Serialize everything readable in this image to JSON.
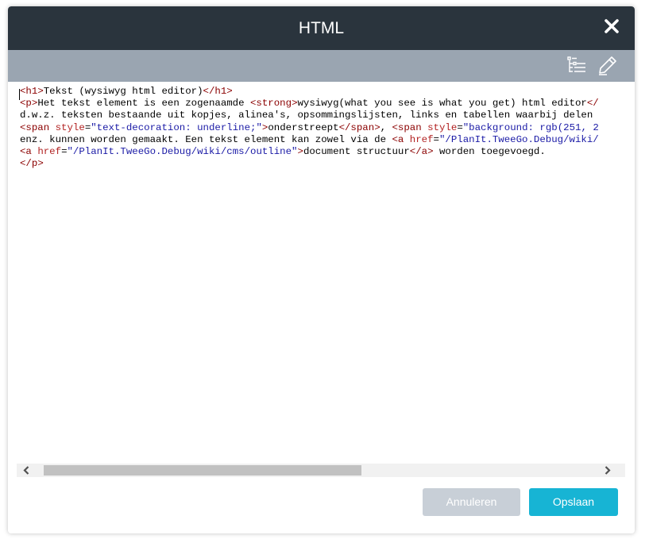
{
  "dialog": {
    "title": "HTML",
    "close_icon": "close-icon"
  },
  "toolbar": {
    "items": [
      {
        "icon": "document-outline-icon"
      },
      {
        "icon": "pencil-icon"
      }
    ]
  },
  "editor": {
    "lines": [
      "<h1>Tekst (wysiwyg html editor)</h1>",
      "<p>Het tekst element is een zogenaamde <strong>wysiwyg(what you see is what you get) html editor</",
      "d.w.z. teksten bestaande uit kopjes, alinea's, opsommingslijsten, links en tabellen waarbij delen",
      "<span style=\"text-decoration: underline;\">onderstreept</span>, <span style=\"background: rgb(251, 2",
      "enz. kunnen worden gemaakt. Een tekst element kan zowel via de <a href=\"/PlanIt.TweeGo.Debug/wiki/",
      "<a href=\"/PlanIt.TweeGo.Debug/wiki/cms/outline\">document structuur</a> worden toegevoegd.",
      "</p>"
    ]
  },
  "scrollbar": {
    "left_icon": "chevron-left-icon",
    "right_icon": "chevron-right-icon"
  },
  "footer": {
    "cancel_label": "Annuleren",
    "save_label": "Opslaan"
  },
  "colors": {
    "header_bg": "#2a343d",
    "toolbar_bg": "#9aa5b1",
    "save_button": "#17b4d4",
    "cancel_button": "#c8cfd7",
    "tag": "#8b0000",
    "attribute": "#b22222",
    "attribute_value": "#1a1aa6"
  }
}
